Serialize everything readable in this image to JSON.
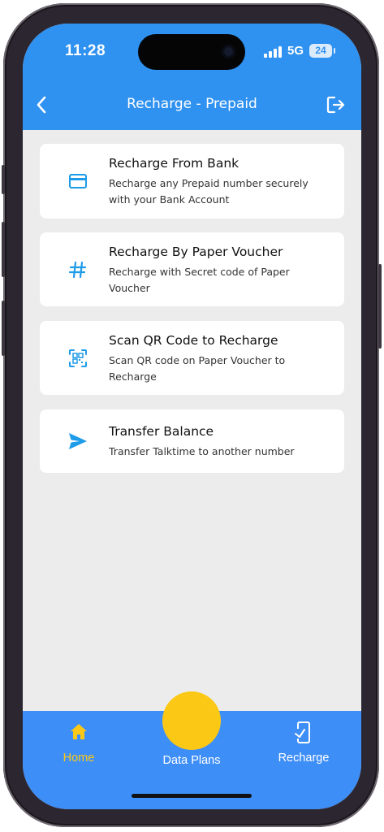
{
  "status_bar": {
    "time": "11:28",
    "network": "5G",
    "battery": "24"
  },
  "header": {
    "title": "Recharge - Prepaid",
    "back_icon": "chevron-left-icon",
    "logout_icon": "logout-icon"
  },
  "options": [
    {
      "icon": "credit-card-icon",
      "title": "Recharge From Bank",
      "description": "Recharge any Prepaid number securely with your Bank Account"
    },
    {
      "icon": "hash-icon",
      "title": "Recharge By Paper Voucher",
      "description": "Recharge with Secret code of Paper Voucher"
    },
    {
      "icon": "qr-code-scan-icon",
      "title": "Scan QR Code to Recharge",
      "description": "Scan QR code on Paper Voucher to Recharge"
    },
    {
      "icon": "send-icon",
      "title": "Transfer Balance",
      "description": "Transfer Talktime to another number"
    }
  ],
  "bottom_nav": {
    "items": [
      {
        "icon": "home-icon",
        "label": "Home",
        "active": true
      },
      {
        "icon": "center-fab",
        "label": "Data Plans",
        "active": false
      },
      {
        "icon": "mobile-check-icon",
        "label": "Recharge",
        "active": false
      }
    ]
  },
  "colors": {
    "header_blue": "#2f91f0",
    "nav_blue": "#3e8ef7",
    "icon_blue": "#1e9be9",
    "active_yellow": "#fbc815",
    "background": "#ececec"
  }
}
